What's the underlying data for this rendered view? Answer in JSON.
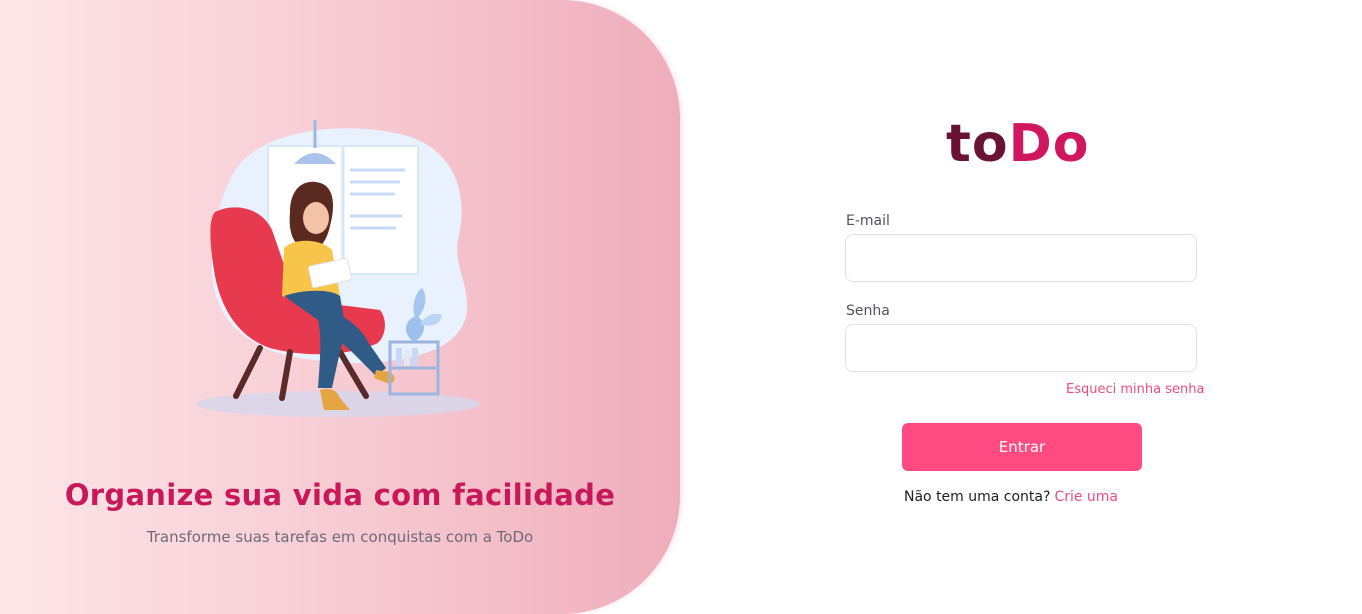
{
  "hero": {
    "headline": "Organize sua vida com facilidade",
    "subline": "Transforme suas tarefas em conquistas com a ToDo"
  },
  "brand": {
    "part1": "to",
    "part2": "Do"
  },
  "form": {
    "email_label": "E-mail",
    "email_value": "",
    "password_label": "Senha",
    "password_value": "",
    "forgot_link": "Esqueci minha senha",
    "submit_label": "Entrar",
    "signup_prompt": "Não tem uma conta?",
    "signup_link": "Crie uma"
  },
  "colors": {
    "brand_dark": "#6a1235",
    "brand_pink": "#d0165f",
    "accent": "#ff4b82",
    "link": "#ec4d7e"
  }
}
